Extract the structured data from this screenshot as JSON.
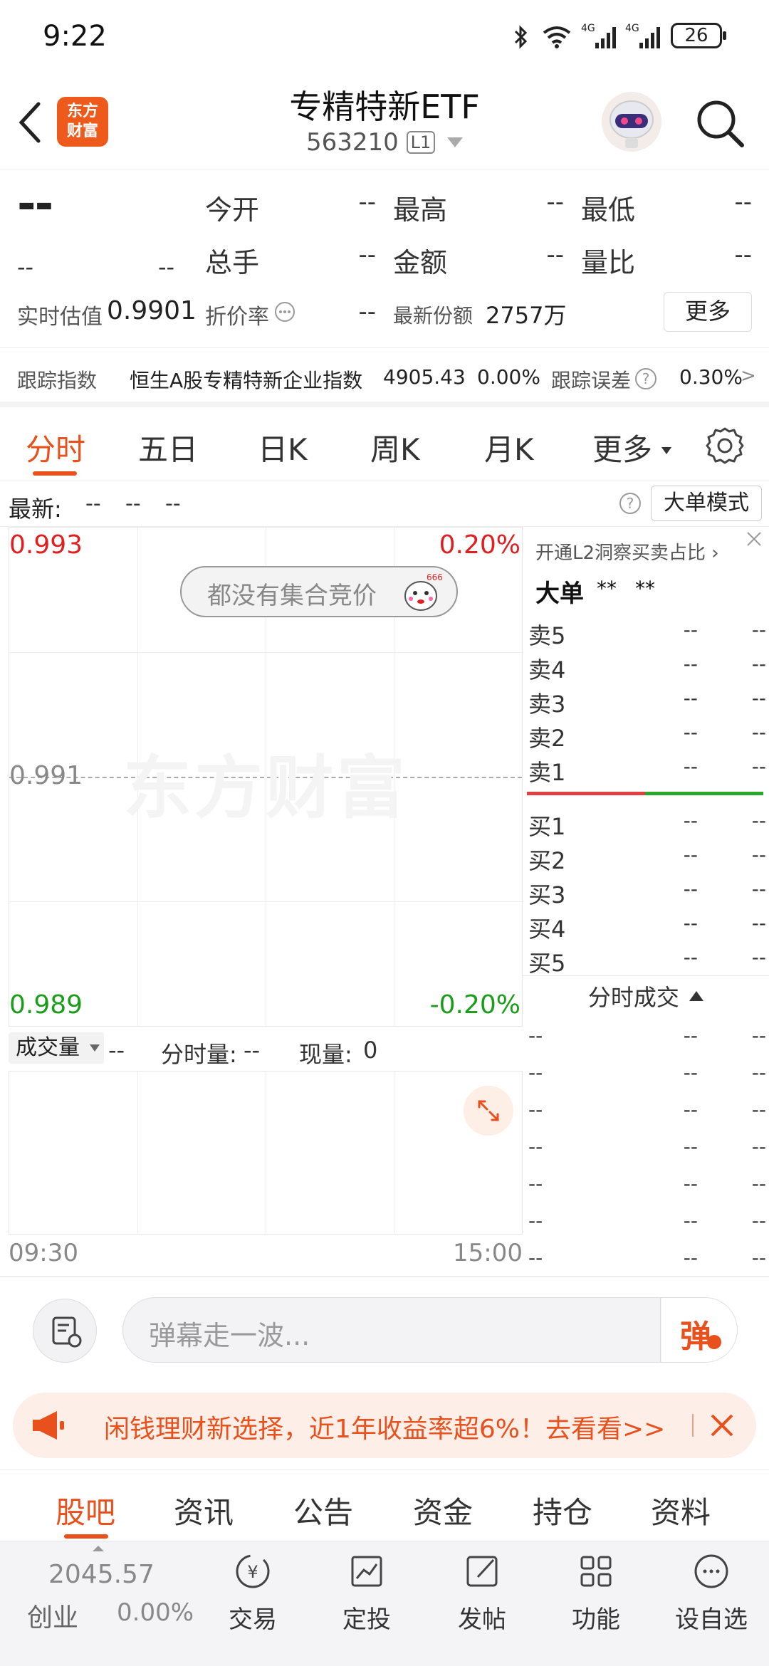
{
  "status_bar": {
    "time": "9:22",
    "battery": "26"
  },
  "header": {
    "logo_top": "东方",
    "logo_bottom": "财富",
    "title": "专精特新ETF",
    "code": "563210",
    "level": "L1"
  },
  "quote": {
    "price": "--",
    "change": "--",
    "change_pct": "--",
    "rows": [
      [
        {
          "label": "今开",
          "value": "--"
        },
        {
          "label": "最高",
          "value": "--"
        },
        {
          "label": "最低",
          "value": "--"
        }
      ],
      [
        {
          "label": "总手",
          "value": "--"
        },
        {
          "label": "金额",
          "value": "--"
        },
        {
          "label": "量比",
          "value": "--"
        }
      ]
    ],
    "iopv_label": "实时估值",
    "iopv_value": "0.9901",
    "premium_label": "折价率",
    "premium_value": "--",
    "shares_label": "最新份额",
    "shares_value": "2757万",
    "more_button": "更多"
  },
  "tracking": {
    "label": "跟踪指数",
    "index_name": "恒生A股专精特新企业指数",
    "index_value": "4905.43",
    "index_change": "0.00%",
    "error_label": "跟踪误差",
    "error_value": "0.30%",
    "arrow": ">"
  },
  "chart_tabs": [
    "分时",
    "五日",
    "日K",
    "周K",
    "月K",
    "更多"
  ],
  "latest_bar": {
    "label": "最新:",
    "v1": "--",
    "v2": "--",
    "v3": "--",
    "mode_button": "大单模式"
  },
  "intraday": {
    "price_top": "0.993",
    "pct_top": "0.20%",
    "price_mid": "0.991",
    "price_bottom": "0.989",
    "pct_bottom": "-0.20%",
    "auction_notice": "都没有集合竞价",
    "watermark": "东方财富",
    "time_start": "09:30",
    "time_end": "15:00"
  },
  "volume_bar": {
    "selector": "成交量",
    "vol_value": "--",
    "fenshi_label": "分时量:",
    "fenshi_value": "--",
    "now_label": "现量:",
    "now_value": "0"
  },
  "order_book": {
    "promo": "开通L2洞察买卖占比",
    "big_label": "大单",
    "big_v1": "**",
    "big_v2": "**",
    "asks": [
      {
        "label": "卖5",
        "price": "--",
        "vol": "--"
      },
      {
        "label": "卖4",
        "price": "--",
        "vol": "--"
      },
      {
        "label": "卖3",
        "price": "--",
        "vol": "--"
      },
      {
        "label": "卖2",
        "price": "--",
        "vol": "--"
      },
      {
        "label": "卖1",
        "price": "--",
        "vol": "--"
      }
    ],
    "bids": [
      {
        "label": "买1",
        "price": "--",
        "vol": "--"
      },
      {
        "label": "买2",
        "price": "--",
        "vol": "--"
      },
      {
        "label": "买3",
        "price": "--",
        "vol": "--"
      },
      {
        "label": "买4",
        "price": "--",
        "vol": "--"
      },
      {
        "label": "买5",
        "price": "--",
        "vol": "--"
      }
    ],
    "trades_title": "分时成交",
    "trades": [
      [
        "--",
        "--",
        "--"
      ],
      [
        "--",
        "--",
        "--"
      ],
      [
        "--",
        "--",
        "--"
      ],
      [
        "--",
        "--",
        "--"
      ],
      [
        "--",
        "--",
        "--"
      ],
      [
        "--",
        "--",
        "--"
      ],
      [
        "--",
        "--",
        "--"
      ]
    ]
  },
  "danmaku": {
    "placeholder": "弹幕走一波...",
    "send": "弹"
  },
  "promo_banner": {
    "text": "闲钱理财新选择，近1年收益率超6%！去看看>>"
  },
  "sub_tabs": [
    "股吧",
    "资讯",
    "公告",
    "资金",
    "持仓",
    "资料"
  ],
  "bottom_nav": {
    "index_value": "2045.57",
    "index_name": "创业",
    "index_change": "0.00%",
    "items": [
      "交易",
      "定投",
      "发帖",
      "功能",
      "设自选"
    ]
  },
  "colors": {
    "accent": "#e8501c",
    "up": "#e02020",
    "down": "#1a9e1a"
  },
  "icons": [
    "back-icon",
    "avatar-robot-icon",
    "search-icon",
    "settings-icon",
    "help-icon",
    "close-icon",
    "expand-icon",
    "danmaku-settings-icon",
    "megaphone-icon",
    "trade-icon",
    "invest-icon",
    "post-icon",
    "apps-icon",
    "add-watch-icon"
  ]
}
